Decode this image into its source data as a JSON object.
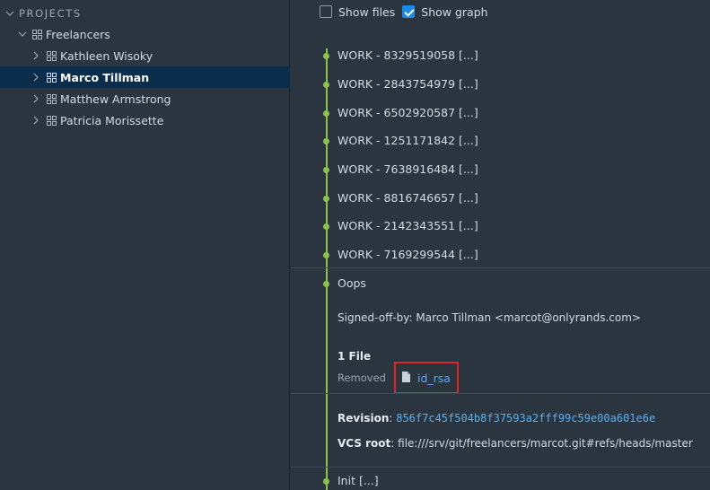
{
  "sidebar": {
    "header": "PROJECTS",
    "group_label": "Freelancers",
    "items": [
      {
        "label": "Kathleen Wisoky"
      },
      {
        "label": "Marco Tillman"
      },
      {
        "label": "Matthew Armstrong"
      },
      {
        "label": "Patricia Morissette"
      }
    ]
  },
  "toolbar": {
    "show_files_label": "Show files",
    "show_graph_label": "Show graph",
    "show_files_checked": false,
    "show_graph_checked": true
  },
  "commits": [
    {
      "label": "WORK - 8329519058 [...]"
    },
    {
      "label": "WORK - 2843754979 [...]"
    },
    {
      "label": "WORK - 6502920587 [...]"
    },
    {
      "label": "WORK - 1251171842 [...]"
    },
    {
      "label": "WORK - 7638916484 [...]"
    },
    {
      "label": "WORK - 8816746657 [...]"
    },
    {
      "label": "WORK - 2142343551 [...]"
    },
    {
      "label": "WORK - 7169299544 [...]"
    }
  ],
  "expanded_commit": {
    "title": "Oops",
    "signed_off": "Signed-off-by: Marco Tillman <marcot@onlyrands.com>",
    "files_heading": "1 File",
    "change_type": "Removed",
    "file_name": "id_rsa",
    "revision_label": "Revision",
    "revision_value": "856f7c45f504b8f37593a2fff99c59e00a601e6e",
    "vcs_root_label": "VCS root",
    "vcs_root_value": "file:///srv/git/freelancers/marcot.git#refs/heads/master"
  },
  "last_commit": {
    "label": "Init [...]"
  },
  "colors": {
    "graph": "#8bc34a",
    "selection": "#0b2d4c",
    "link": "#58a6ff",
    "highlight_box": "#e02424"
  }
}
